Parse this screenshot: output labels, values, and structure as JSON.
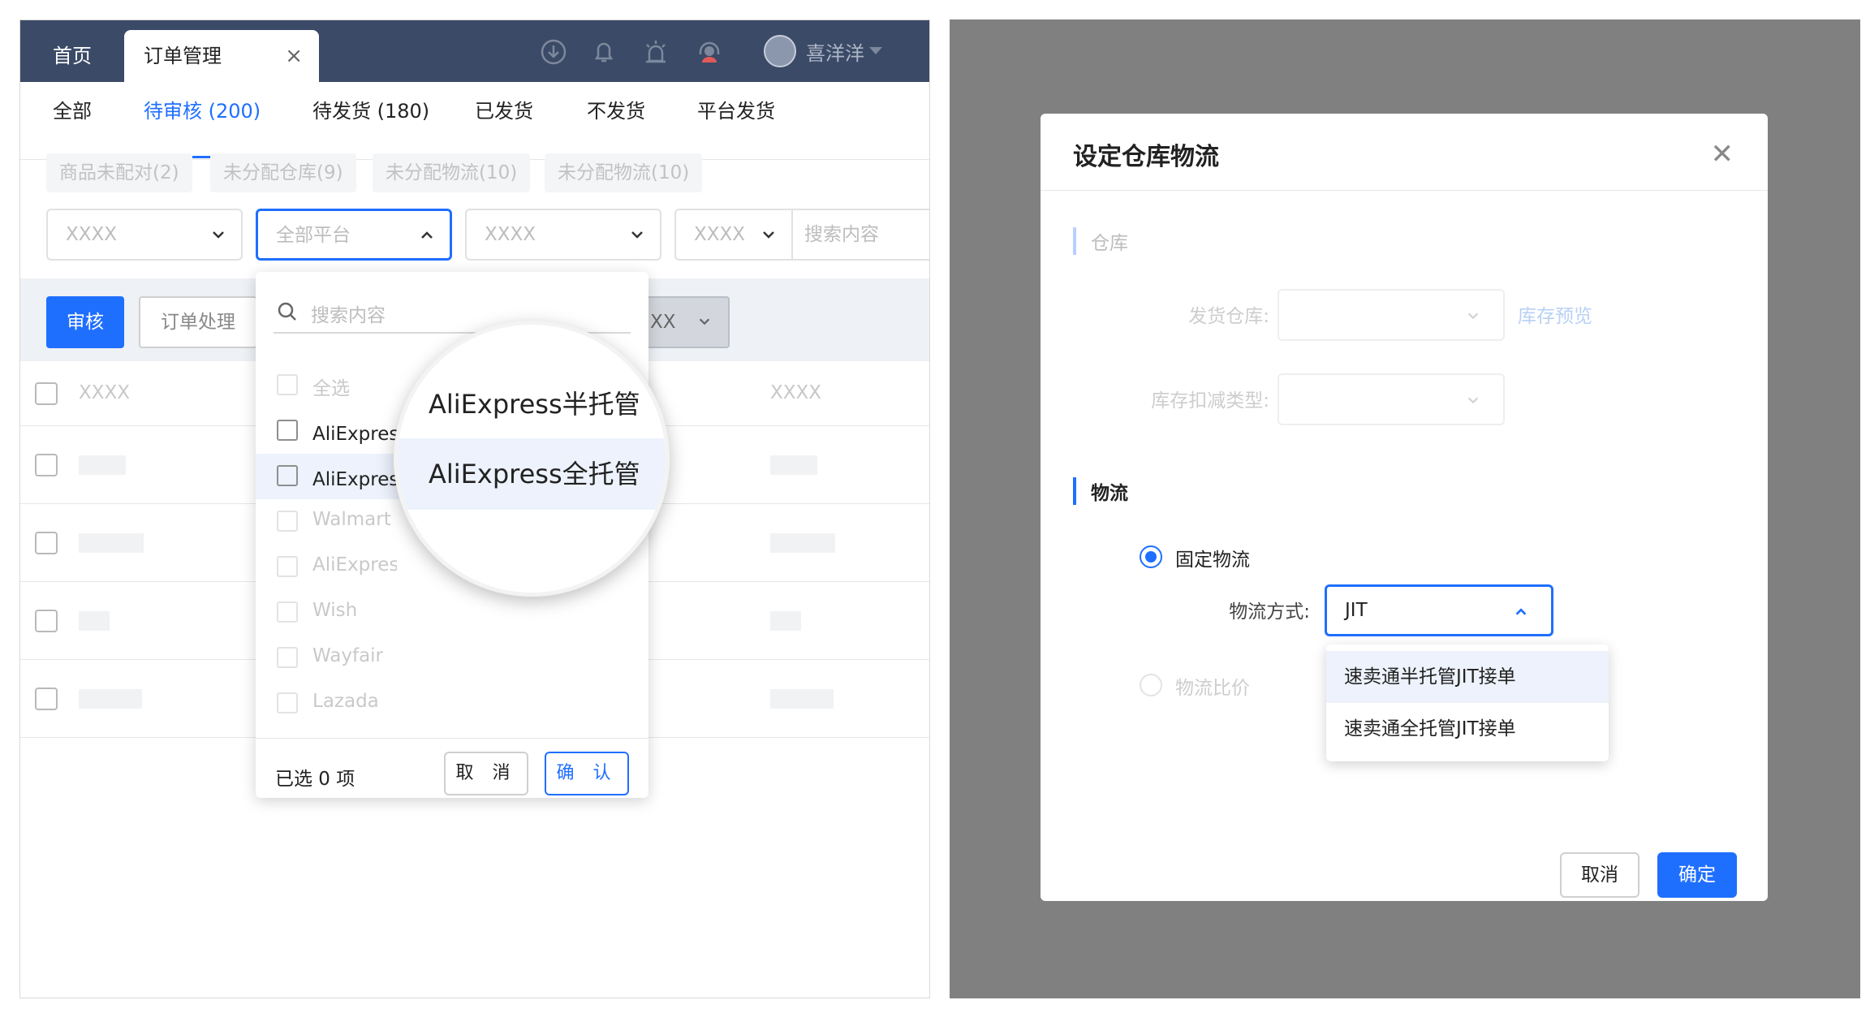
{
  "topbar": {
    "tabs": [
      {
        "label": "首页"
      },
      {
        "label": "订单管理"
      }
    ],
    "close_glyph": "×",
    "user_name": "喜洋洋",
    "icons": [
      "download-icon",
      "bell-icon",
      "alarm-icon",
      "headset-icon"
    ]
  },
  "subtabs": [
    {
      "label": "全部"
    },
    {
      "label": "待审核 (200)",
      "active": true
    },
    {
      "label": "待发货 (180)"
    },
    {
      "label": "已发货"
    },
    {
      "label": "不发货"
    },
    {
      "label": "平台发货"
    }
  ],
  "chips": [
    "商品未配对(2)",
    "未分配仓库(9)",
    "未分配物流(10)",
    "未分配物流(10)"
  ],
  "filters": {
    "select1": "XXXX",
    "platform": "全部平台",
    "select3": "XXXX",
    "select4": "XXXX",
    "search_placeholder": "搜索内容"
  },
  "toolbar": {
    "review": "审核",
    "process": "订单处理",
    "xx": "XX"
  },
  "table": {
    "col1": "XXXX",
    "col3": "XXXX"
  },
  "dropdown": {
    "search_placeholder": "搜索内容",
    "options": [
      "全选",
      "AliExpress半托管",
      "AliExpress全托管",
      "Walmart",
      "AliExpress",
      "Wish",
      "Wayfair",
      "Lazada"
    ],
    "selected_count": "已选 0 项",
    "cancel": "取 消",
    "ok": "确 认"
  },
  "magnifier": {
    "opt1": "AliExpress半托管",
    "opt2": "AliExpress全托管"
  },
  "modal": {
    "title": "设定仓库物流",
    "close_glyph": "✕",
    "section_warehouse": "仓库",
    "ship_warehouse_label": "发货仓库:",
    "stock_preview_link": "库存预览",
    "deduct_type_label": "库存扣减类型:",
    "section_logistics": "物流",
    "fixed_logistics": "固定物流",
    "method_label": "物流方式:",
    "method_value": "JIT",
    "method_options": [
      "速卖通半托管JIT接单",
      "速卖通全托管JIT接单"
    ],
    "ratio_logistics": "物流比价",
    "cancel": "取消",
    "ok": "确定"
  },
  "colors": {
    "primary": "#1f6fff",
    "topbar": "#3b4a66",
    "overlay": "#808080"
  }
}
